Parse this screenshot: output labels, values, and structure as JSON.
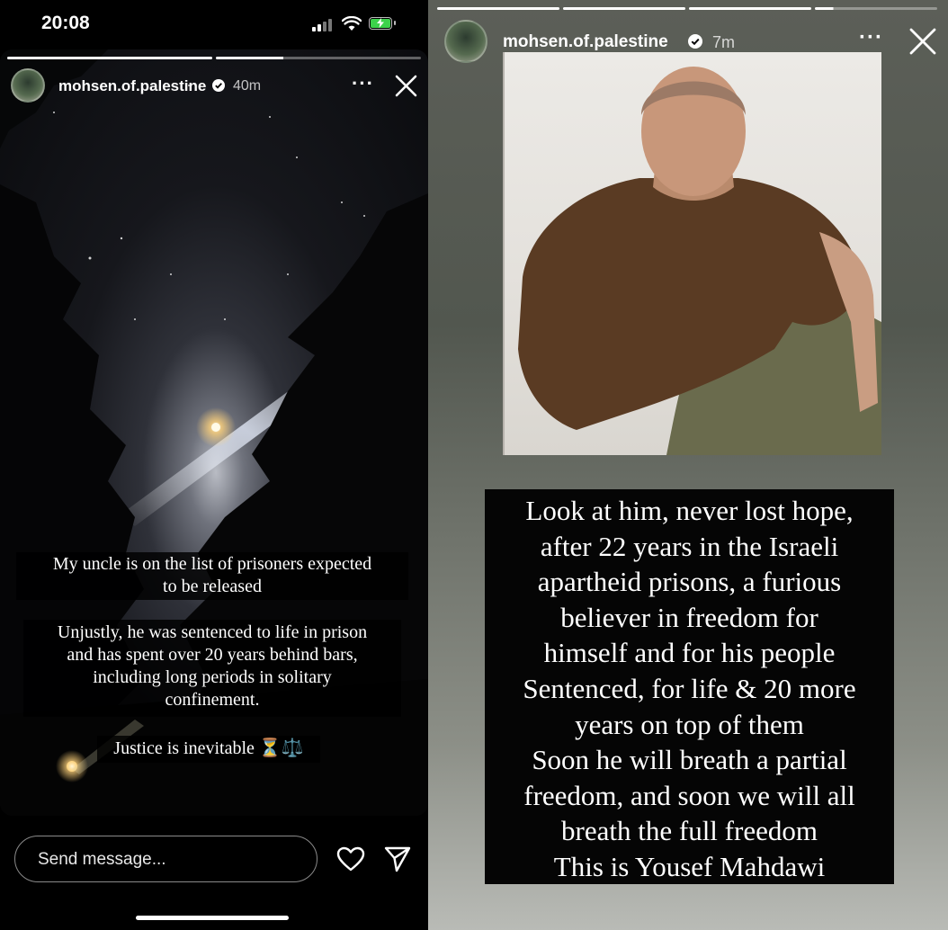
{
  "status_bar": {
    "time": "20:08"
  },
  "left_story": {
    "username": "mohsen.of.palestine",
    "time_ago": "40m",
    "progress": {
      "segments": 2,
      "current": 2
    },
    "captions": [
      "My uncle is on the list of prisoners expected",
      "to be released",
      "Unjustly, he was sentenced to life in prison",
      "and has spent over 20 years behind bars,",
      "including long periods in solitary",
      "confinement.",
      "Justice is inevitable ⏳⚖️"
    ],
    "reply": {
      "placeholder": "Send message..."
    },
    "icons": [
      "verified-badge-icon",
      "more-options-icon",
      "close-icon",
      "heart-icon",
      "send-icon"
    ]
  },
  "right_story": {
    "username": "mohsen.of.palestine",
    "time_ago": "7m",
    "progress": {
      "segments": 4,
      "current": 4
    },
    "caption_lines": [
      "Look at him, never lost hope,",
      "after 22 years in the Israeli",
      "apartheid prisons, a furious",
      "believer in freedom for",
      "himself and for his people",
      "Sentenced, for life & 20 more",
      "years on top of them",
      "Soon he will breath a partial",
      "freedom, and soon we will all",
      "breath the full freedom",
      "This is Yousef Mahdawi"
    ]
  },
  "colors": {
    "background": "#000000",
    "battery_green": "#3cd24b",
    "text": "#ffffff"
  }
}
